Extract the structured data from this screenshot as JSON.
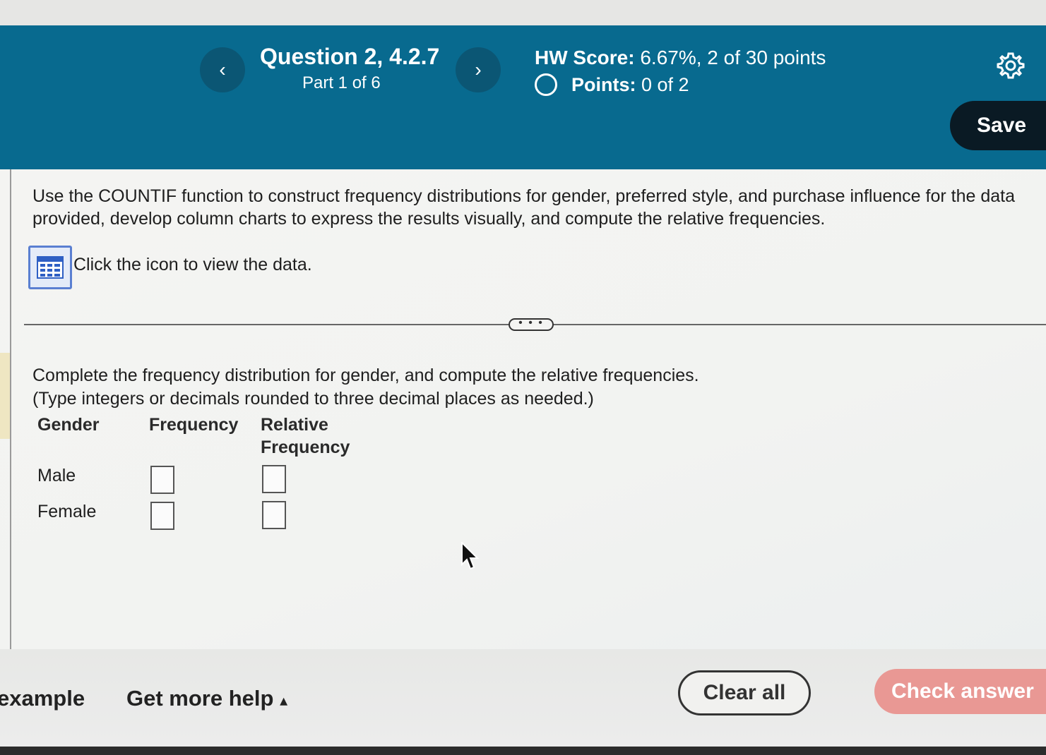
{
  "header": {
    "prev_icon": "chevron-left-icon",
    "prev_glyph": "‹",
    "next_icon": "chevron-right-icon",
    "next_glyph": "›",
    "question_title": "Question 2, 4.2.7",
    "part": "Part 1 of 6",
    "hw_score_label": "HW Score:",
    "hw_score_value": "6.67%, 2 of 30 points",
    "points_label": "Points:",
    "points_value": "0 of 2",
    "settings_icon": "gear-icon",
    "save_label": "Save"
  },
  "question": {
    "text": "Use the COUNTIF function to construct frequency distributions for gender, preferred style, and purchase influence for the data provided, develop column charts to express the results visually, and compute the relative frequencies.",
    "data_icon": "table-grid-icon",
    "data_link": "Click the icon to view the data.",
    "expander": "• • •"
  },
  "part1": {
    "instruction": "Complete the frequency distribution for gender, and compute the relative frequencies.",
    "note": "(Type integers or decimals rounded to three decimal places as needed.)",
    "columns": [
      "Gender",
      "Frequency",
      "Relative Frequency"
    ],
    "rows": [
      {
        "label": "Male",
        "frequency": "",
        "relative": ""
      },
      {
        "label": "Female",
        "frequency": "",
        "relative": ""
      }
    ]
  },
  "footer": {
    "example_label": "example",
    "help_label": "Get more help",
    "help_icon": "caret-up-icon",
    "help_glyph": "▴",
    "clear_label": "Clear all",
    "check_label": "Check answer"
  },
  "colors": {
    "header_bg": "#086a8f",
    "nav_button": "#0b5674",
    "save_bg": "#0a1a24",
    "check_answer_bg": "#e99894",
    "data_icon_border": "#5a7fd1"
  }
}
